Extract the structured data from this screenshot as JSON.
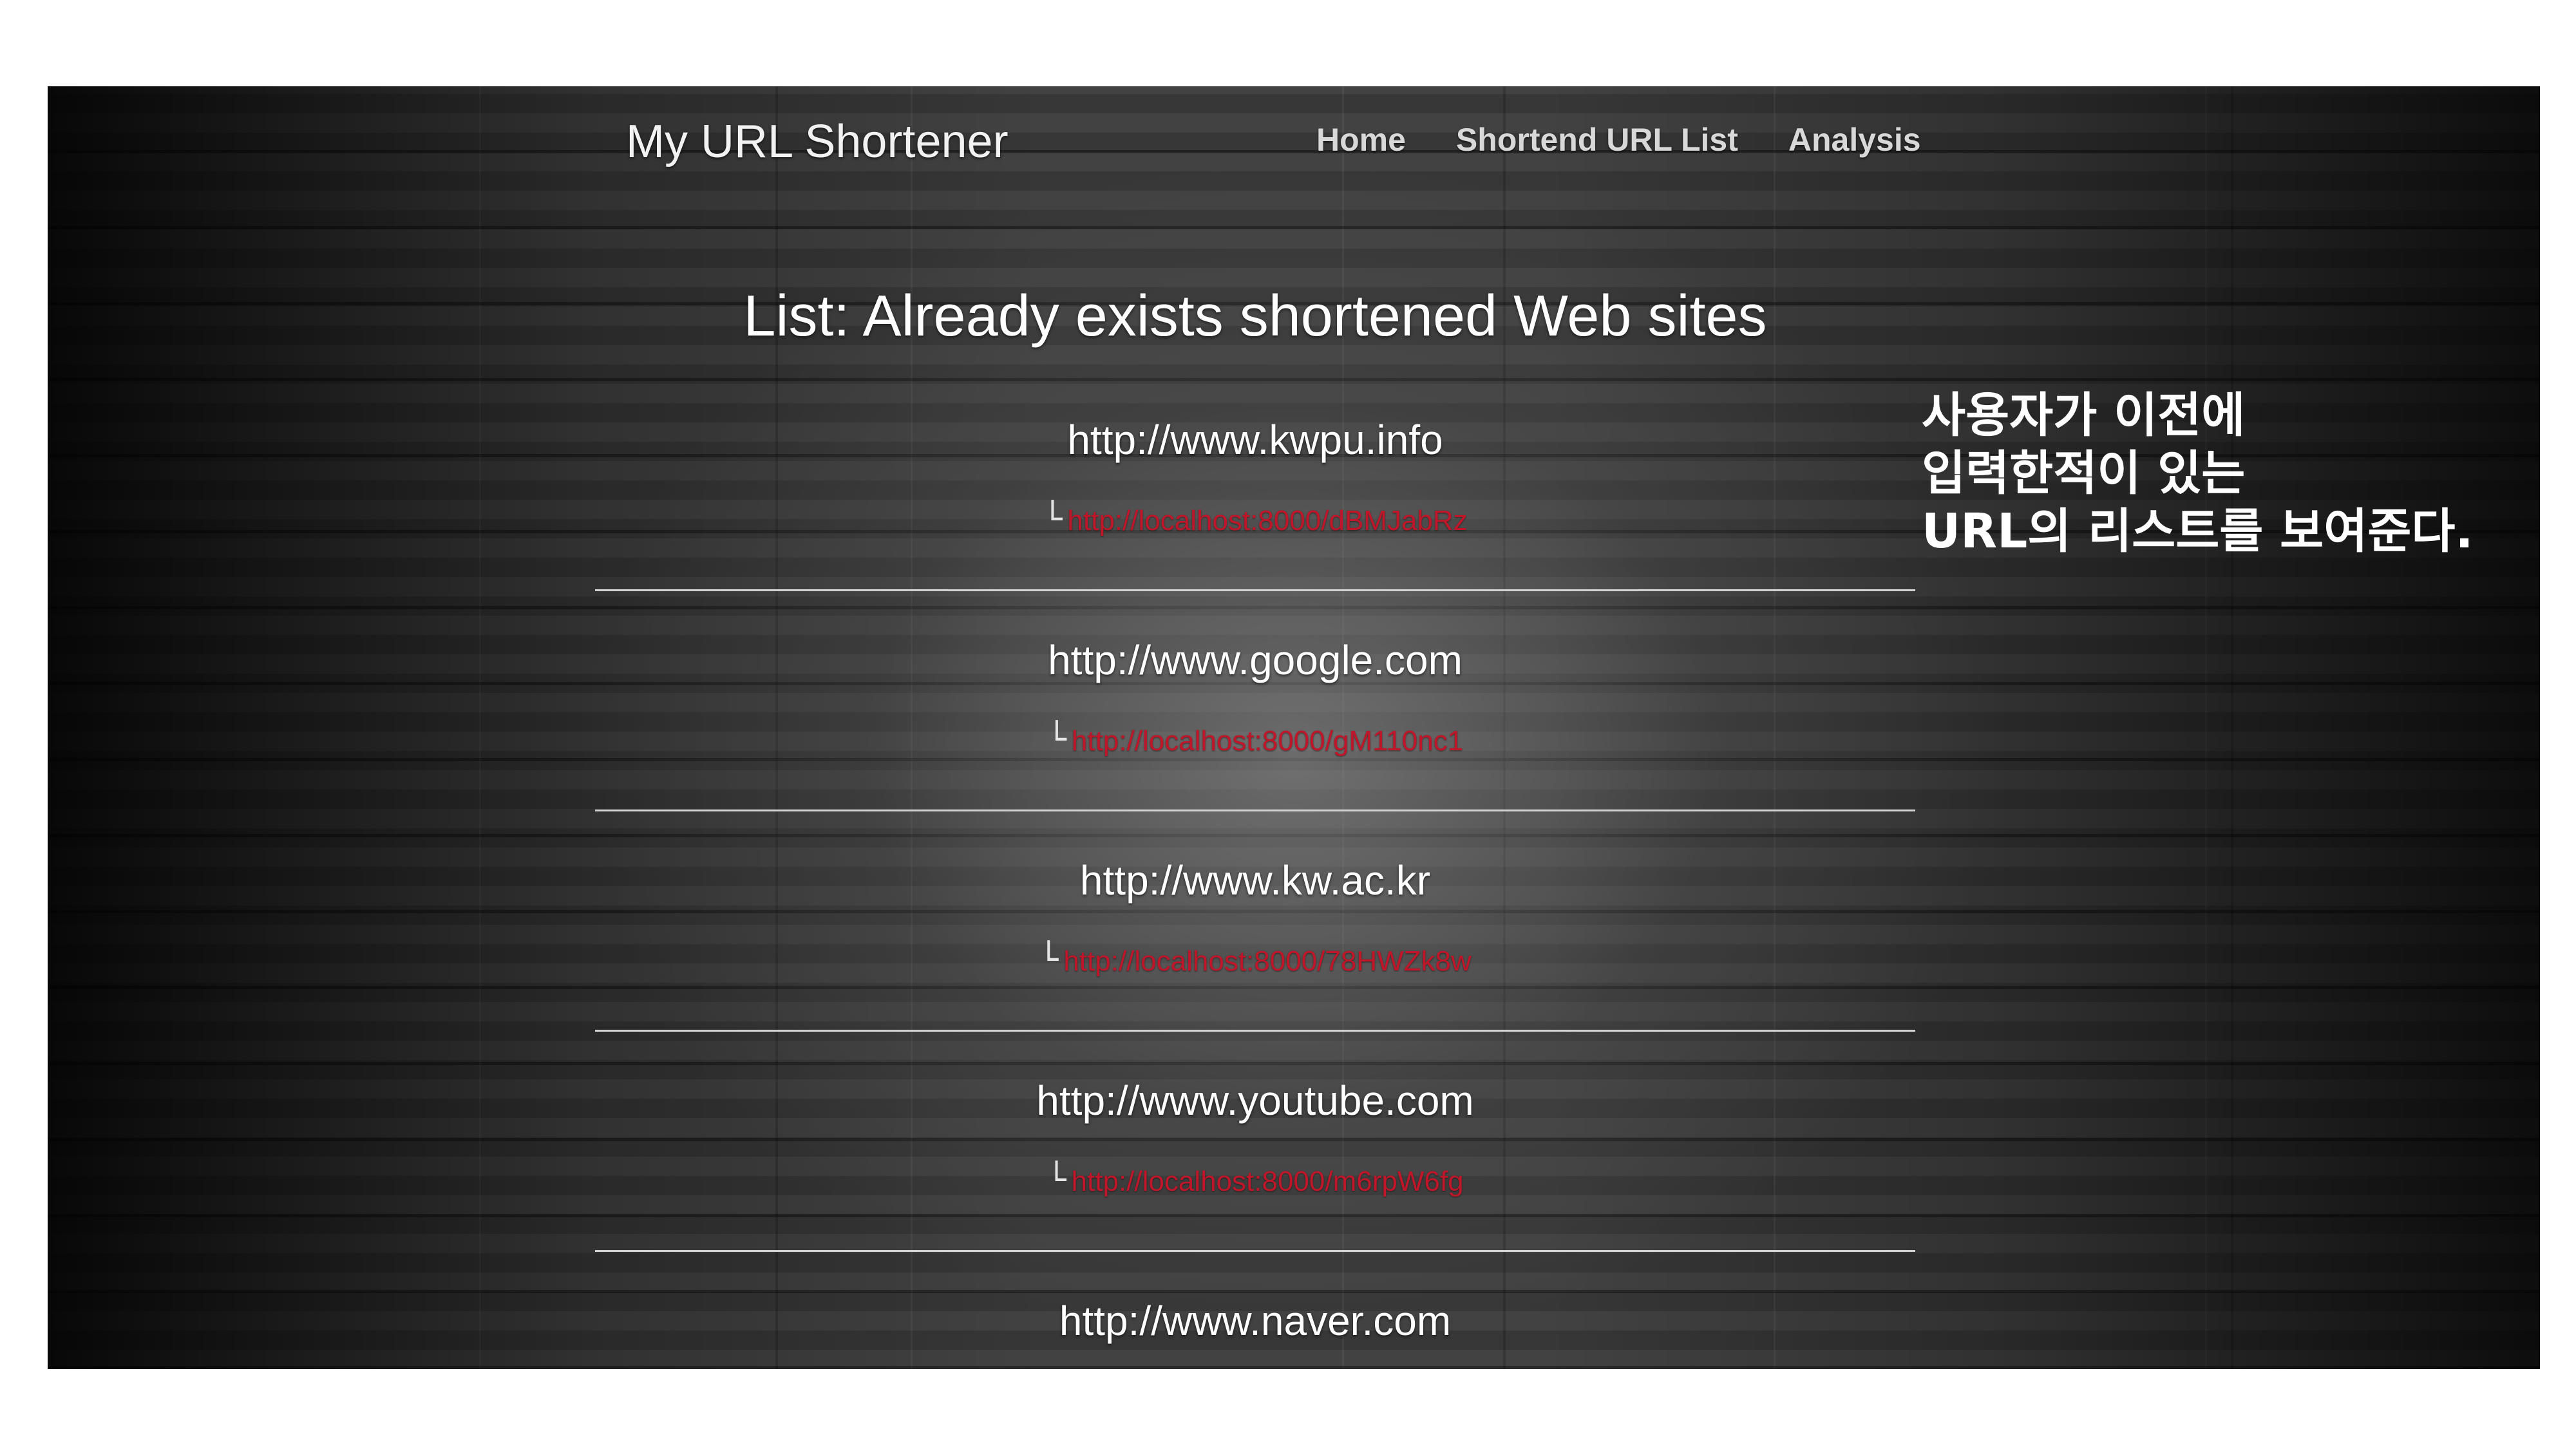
{
  "brand": "My URL Shortener",
  "nav": {
    "items": [
      "Home",
      "Shortend URL List",
      "Analysis"
    ]
  },
  "list_title": "List: Already exists shortened Web sites",
  "arrow_glyph": "└",
  "entries": [
    {
      "original": "http://www.kwpu.info",
      "short": "http://localhost:8000/dBMJabRz"
    },
    {
      "original": "http://www.google.com",
      "short": "http://localhost:8000/gM110nc1"
    },
    {
      "original": "http://www.kw.ac.kr",
      "short": "http://localhost:8000/78HWZk8w"
    },
    {
      "original": "http://www.youtube.com",
      "short": "http://localhost:8000/m6rpW6fg"
    },
    {
      "original": "http://www.naver.com",
      "short": ""
    }
  ],
  "annotation": {
    "lines": [
      "사용자가 이전에",
      "입력한적이 있는",
      "URL의 리스트를 보여준다."
    ]
  }
}
